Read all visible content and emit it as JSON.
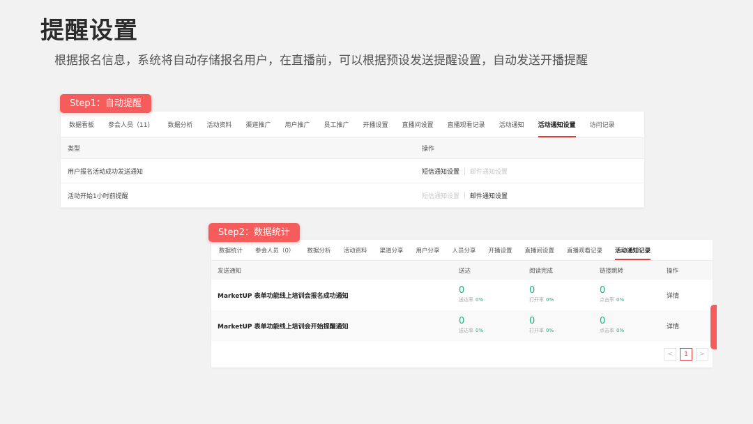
{
  "title": "提醒设置",
  "subtitle": "根据报名信息，系统将自动存储报名用户，在直播前，可以根据预设发送提醒设置，自动发送开播提醒",
  "step1": {
    "label": "Step1：自动提醒",
    "tabs": [
      "数据看板",
      "参会人员（11）",
      "数据分析",
      "活动资料",
      "渠道推广",
      "用户推广",
      "员工推广",
      "开播设置",
      "直播间设置",
      "直播观看记录",
      "活动通知",
      "活动通知设置",
      "访问记录"
    ],
    "active_tab": "活动通知设置",
    "headers": {
      "type": "类型",
      "action": "操作"
    },
    "rows": [
      {
        "type": "用户报名活动成功发送通知",
        "sms": "短信通知设置",
        "email": "邮件通知设置"
      },
      {
        "type": "活动开始1小时前提醒",
        "sms": "短信通知设置",
        "email": "邮件通知设置"
      }
    ]
  },
  "step2": {
    "label": "Step2：数据统计",
    "tabs": [
      "数据统计",
      "参会人员（0）",
      "数据分析",
      "活动资料",
      "渠道分享",
      "用户分享",
      "人员分享",
      "开播设置",
      "直播间设置",
      "直播观看记录",
      "活动通知记录"
    ],
    "active_tab": "活动通知记录",
    "headers": {
      "name": "发送通知",
      "delivered": "送达",
      "read": "阅读完成",
      "click": "链接跳转",
      "action": "操作"
    },
    "rows": [
      {
        "name": "MarketUP 表单功能线上培训会报名成功通知",
        "delivered": "0",
        "delivered_label": "送达率",
        "delivered_pct": "0%",
        "read": "0",
        "read_label": "打开率",
        "read_pct": "0%",
        "click": "0",
        "click_label": "点击率",
        "click_pct": "0%",
        "detail": "详情"
      },
      {
        "name": "MarketUP 表单功能线上培训会开始提醒通知",
        "delivered": "0",
        "delivered_label": "送达率",
        "delivered_pct": "0%",
        "read": "0",
        "read_label": "打开率",
        "read_pct": "0%",
        "click": "0",
        "click_label": "点击率",
        "click_pct": "0%",
        "detail": "详情"
      }
    ],
    "pager": {
      "prev": "<",
      "current": "1",
      "next": ">"
    }
  },
  "colors": {
    "accent": "#f65c5c",
    "active_underline": "#e53935",
    "stat_green": "#19b37c"
  }
}
